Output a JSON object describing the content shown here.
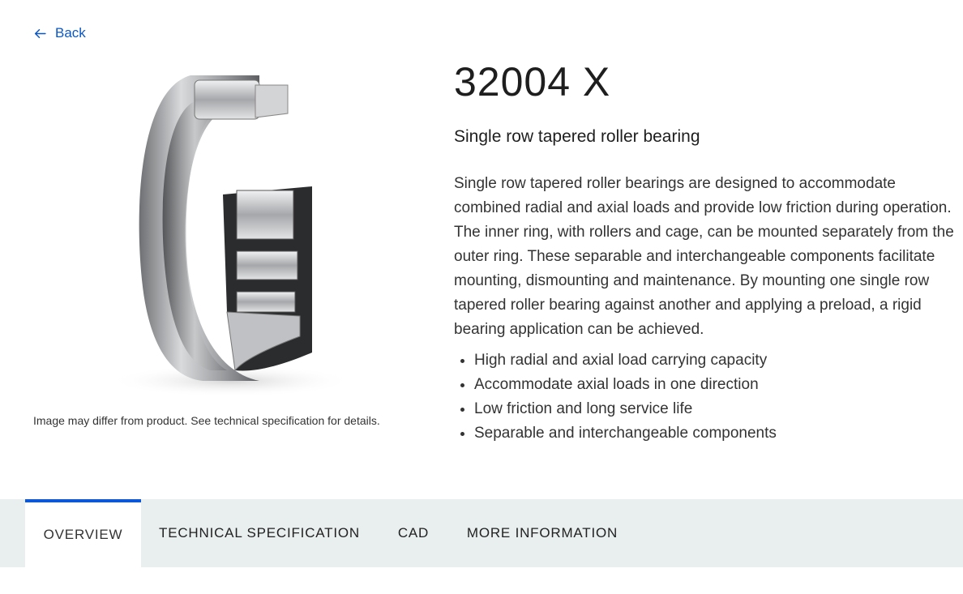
{
  "back": {
    "label": "Back"
  },
  "image": {
    "caption": "Image may differ from product. See technical specification for details."
  },
  "product": {
    "title": "32004 X",
    "subtitle": "Single row tapered roller bearing",
    "description": "Single row tapered roller bearings are designed to accommodate combined radial and axial loads and provide low friction during operation. The inner ring, with rollers and cage, can be mounted separately from the outer ring. These separable and interchangeable components facilitate mounting, dismounting and maintenance. By mounting one single row tapered roller bearing against another and applying a preload, a rigid bearing application can be achieved.",
    "features": [
      "High radial and axial load carrying capacity",
      "Accommodate axial loads in one direction",
      "Low friction and long service life",
      "Separable and interchangeable components"
    ]
  },
  "tabs": [
    {
      "label": "OVERVIEW",
      "active": true
    },
    {
      "label": "TECHNICAL SPECIFICATION",
      "active": false
    },
    {
      "label": "CAD",
      "active": false
    },
    {
      "label": "MORE INFORMATION",
      "active": false
    }
  ],
  "colors": {
    "link": "#0b57c2",
    "tab_bar": "#e9eeee",
    "active_tab_indicator": "#0b57d8"
  }
}
